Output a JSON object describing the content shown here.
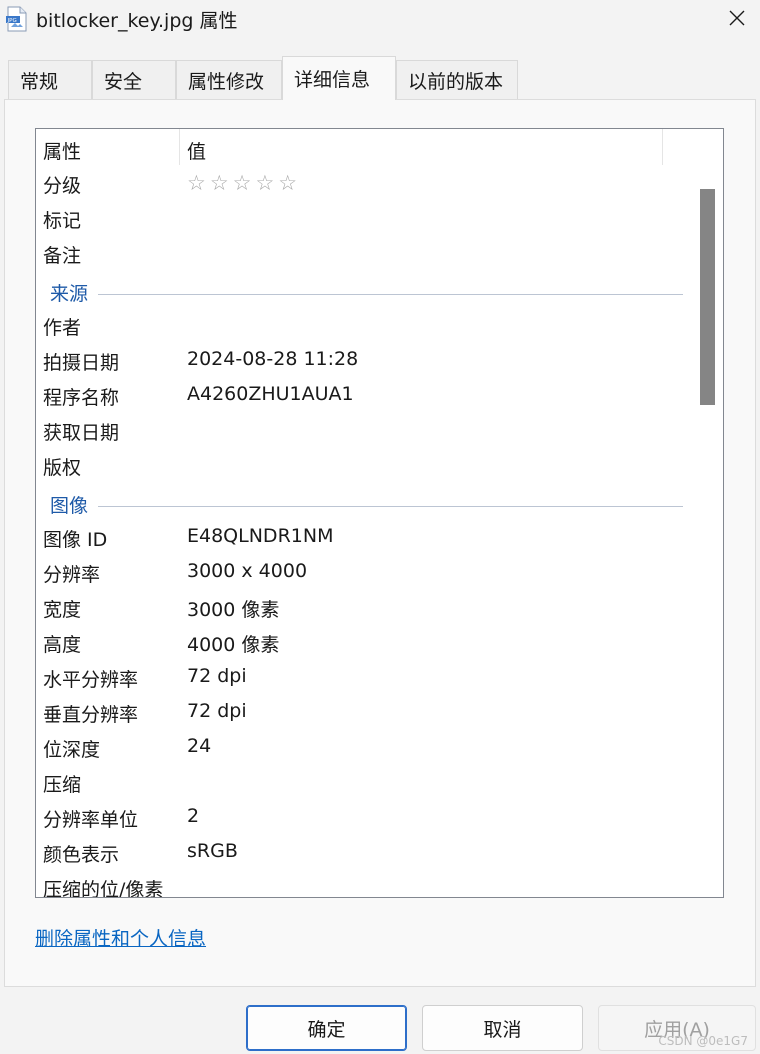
{
  "window": {
    "title": "bitlocker_key.jpg 属性",
    "icon": "jpg-file-icon",
    "close_glyph": "✕"
  },
  "tabs": [
    {
      "label": "常规"
    },
    {
      "label": "安全"
    },
    {
      "label": "属性修改"
    },
    {
      "label": "详细信息",
      "active": true
    },
    {
      "label": "以前的版本"
    }
  ],
  "list": {
    "headers": {
      "property": "属性",
      "value": "值"
    },
    "rows_top": [
      {
        "label": "分级",
        "value": "",
        "rating": "☆☆☆☆☆"
      },
      {
        "label": "标记",
        "value": ""
      },
      {
        "label": "备注",
        "value": ""
      }
    ],
    "group_source": "来源",
    "rows_source": [
      {
        "label": "作者",
        "value": ""
      },
      {
        "label": "拍摄日期",
        "value": "2024-08-28 11:28"
      },
      {
        "label": "程序名称",
        "value": "A4260ZHU1AUA1"
      },
      {
        "label": "获取日期",
        "value": ""
      },
      {
        "label": "版权",
        "value": ""
      }
    ],
    "group_image": "图像",
    "rows_image": [
      {
        "label": "图像 ID",
        "value": "E48QLNDR1NM"
      },
      {
        "label": "分辨率",
        "value": "3000 x 4000"
      },
      {
        "label": "宽度",
        "value": "3000 像素"
      },
      {
        "label": "高度",
        "value": "4000 像素"
      },
      {
        "label": "水平分辨率",
        "value": "72 dpi"
      },
      {
        "label": "垂直分辨率",
        "value": "72 dpi"
      },
      {
        "label": "位深度",
        "value": "24"
      },
      {
        "label": "压缩",
        "value": ""
      },
      {
        "label": "分辨率单位",
        "value": "2"
      },
      {
        "label": "颜色表示",
        "value": "sRGB"
      },
      {
        "label": "压缩的位/像素",
        "value": ""
      }
    ]
  },
  "remove_link": "删除属性和个人信息",
  "buttons": {
    "ok": "确定",
    "cancel": "取消",
    "apply": "应用(A)"
  },
  "watermark": "CSDN @0e1G7"
}
